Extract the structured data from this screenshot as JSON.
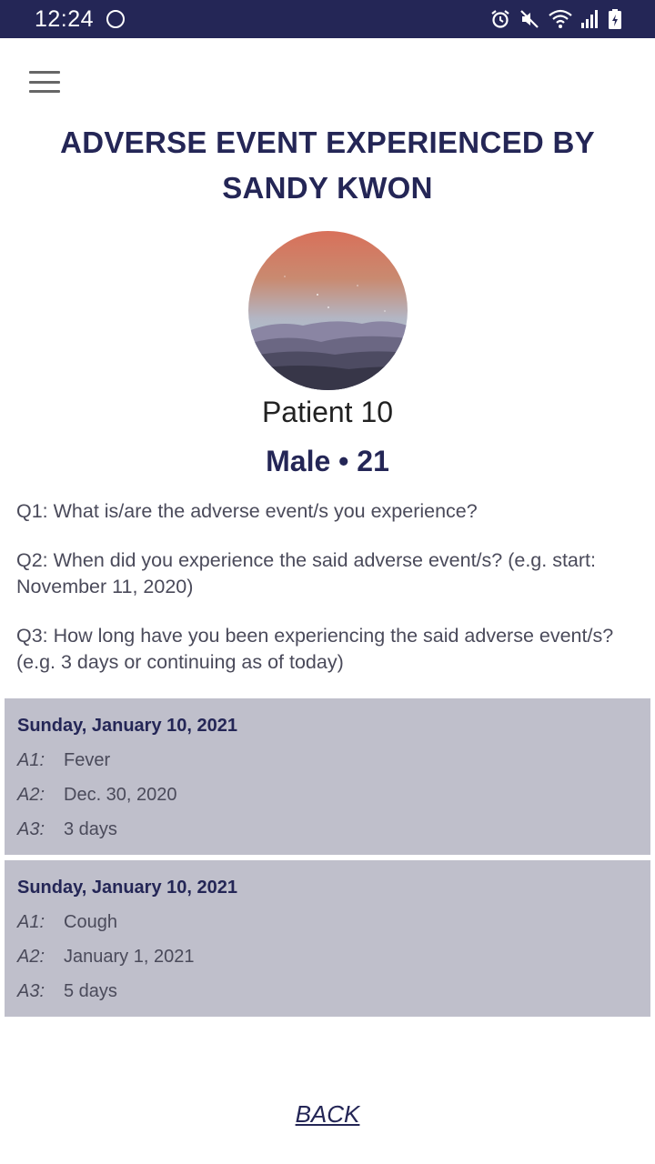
{
  "status_bar": {
    "time": "12:24",
    "icons": [
      "circle-icon",
      "alarm-icon",
      "mute-icon",
      "wifi-icon",
      "signal-icon",
      "battery-icon"
    ]
  },
  "header": {
    "menu_icon": "hamburger-menu-icon",
    "title": "ADVERSE EVENT EXPERIENCED BY SANDY KWON"
  },
  "patient": {
    "name": "Patient 10",
    "meta": "Male • 21"
  },
  "questions": [
    "Q1: What is/are the adverse event/s you experience?",
    "Q2: When did you experience the said adverse event/s? (e.g. start: November 11, 2020)",
    "Q3: How long have you been experiencing the said adverse event/s? (e.g. 3 days or continuing as of today)"
  ],
  "entries": [
    {
      "date": "Sunday, January 10, 2021",
      "rows": [
        {
          "label": "A1:",
          "value": "Fever"
        },
        {
          "label": "A2:",
          "value": "Dec. 30, 2020"
        },
        {
          "label": "A3:",
          "value": "3 days"
        }
      ]
    },
    {
      "date": "Sunday, January 10, 2021",
      "rows": [
        {
          "label": "A1:",
          "value": "Cough"
        },
        {
          "label": "A2:",
          "value": "January 1, 2021"
        },
        {
          "label": "A3:",
          "value": "5 days"
        }
      ]
    }
  ],
  "footer": {
    "back_label": "BACK"
  },
  "colors": {
    "primary": "#242656",
    "card_bg": "#bfbfcb",
    "text": "#4a4a5a"
  }
}
